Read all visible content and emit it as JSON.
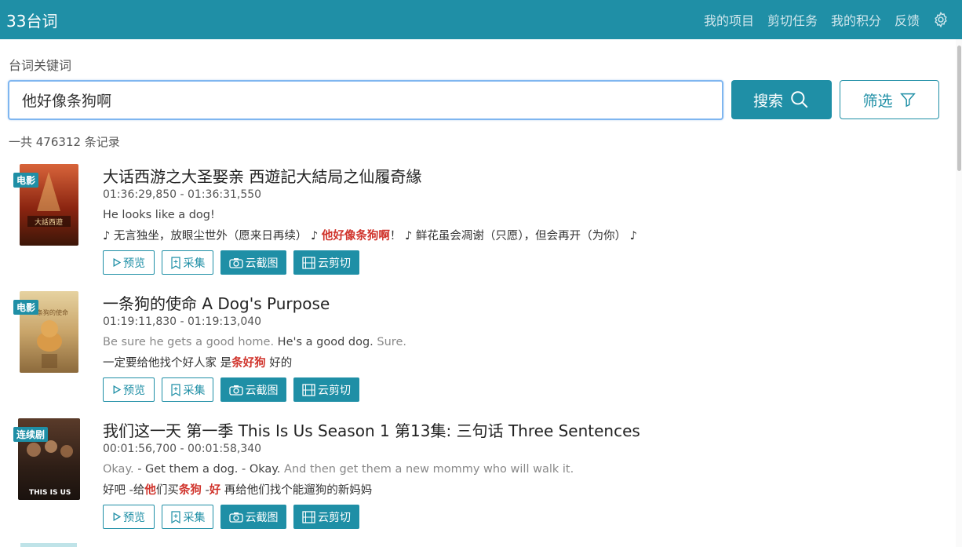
{
  "header": {
    "brand": "33台词",
    "nav": [
      "我的项目",
      "剪切任务",
      "我的积分",
      "反馈"
    ]
  },
  "search": {
    "label": "台词关键词",
    "value": "他好像条狗啊",
    "search_button": "搜索",
    "filter_button": "筛选"
  },
  "total": "一共 476312 条记录",
  "actions": {
    "preview": "预览",
    "collect": "采集",
    "screenshot": "云截图",
    "cut": "云剪切"
  },
  "results": [
    {
      "badge": "电影",
      "title": "大话西游之大圣娶亲 西遊記大結局之仙履奇緣",
      "time": "01:36:29,850 - 01:36:31,550",
      "en_prev": "",
      "en_main": " He looks like a dog!",
      "en_next": "",
      "zh_prev": "♪ 无言独坐，放眼尘世外（愿来日再续） ♪ ",
      "zh_hl": "他好像条狗啊",
      "zh_after": "！ ♪ 鲜花虽会凋谢（只愿），但会再开（为你） ♪",
      "poster_color": "#b8421e"
    },
    {
      "badge": "电影",
      "title": "一条狗的使命 A Dog's Purpose",
      "time": "01:19:11,830 - 01:19:13,040",
      "en_prev": "Be sure he gets a good home.  ",
      "en_main": "He's a good dog.",
      "en_next": " Sure.",
      "zh_prev": "一定要给他找个好人家  是",
      "zh_hl": "条好狗",
      "zh_after": " 好的",
      "poster_color": "#c9a56a"
    },
    {
      "badge": "连续剧",
      "title": "我们这一天 第一季 This Is Us Season 1 第13集: 三句话 Three Sentences",
      "time": "00:01:56,700 - 00:01:58,340",
      "en_prev": "Okay.  ",
      "en_main": "- Get them a dog. - Okay.",
      "en_next": " And then get them a new mommy who will walk it.",
      "zh_prev": "好吧  -给",
      "zh_hl": "他",
      "zh_mid": "们买",
      "zh_hl2": "条狗",
      "zh_mid2": " -",
      "zh_hl3": "好",
      "zh_after": " 再给他们找个能遛狗的新妈妈",
      "poster_color": "#3a2a22"
    }
  ]
}
